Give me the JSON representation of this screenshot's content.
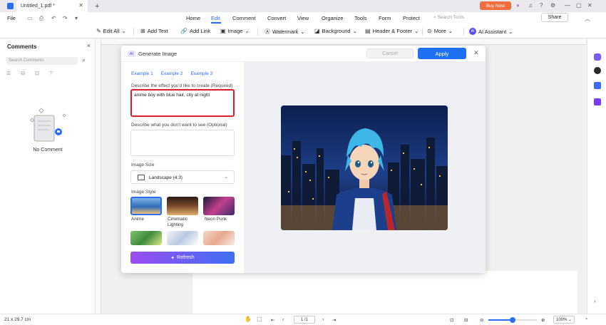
{
  "titlebar": {
    "doc_title": "Untitled_1.pdf *",
    "close_tab": "✕",
    "new_tab": "+",
    "buy_now": "Buy Now"
  },
  "menubar": {
    "file": "File",
    "items": [
      "Home",
      "Edit",
      "Comment",
      "Convert",
      "View",
      "Organize",
      "Tools",
      "Form",
      "Protect"
    ],
    "active": "Edit",
    "search_placeholder": "Search Tools",
    "share": "Share"
  },
  "toolbar": {
    "tools": [
      "Edit All",
      "Add Text",
      "Add Link",
      "Image",
      "Watermark",
      "Background",
      "Header & Footer",
      "More",
      "AI Assistant"
    ]
  },
  "comments_panel": {
    "title": "Comments",
    "search_placeholder": "Search Comments",
    "empty_text": "No Comment"
  },
  "dialog": {
    "ai_tag": "AI",
    "title": "Generate Image",
    "cancel": "Cancel",
    "apply": "Apply",
    "examples": [
      "Example 1",
      "Example 2",
      "Example 3"
    ],
    "describe_label": "Describe the effect you'd like to create (Required)",
    "describe_value": "anime boy with blue hair, city at night",
    "negative_label": "Describe what you don't want to see (Optional)",
    "negative_value": "",
    "size_label": "Image Size",
    "size_value": "Landscape (4:3)",
    "style_label": "Image Style",
    "styles": [
      "Anime",
      "Cinematic Lighting",
      "Neon Punk"
    ],
    "refresh": "Refresh"
  },
  "statusbar": {
    "page_size": "21 x 29.7 cm",
    "page_indicator": "1 /1",
    "zoom": "100%",
    "zoom_level": 0.5
  },
  "colors": {
    "accent": "#1f6ff2",
    "highlight_border": "#d9202a",
    "buy_now": "#f26d3d"
  }
}
